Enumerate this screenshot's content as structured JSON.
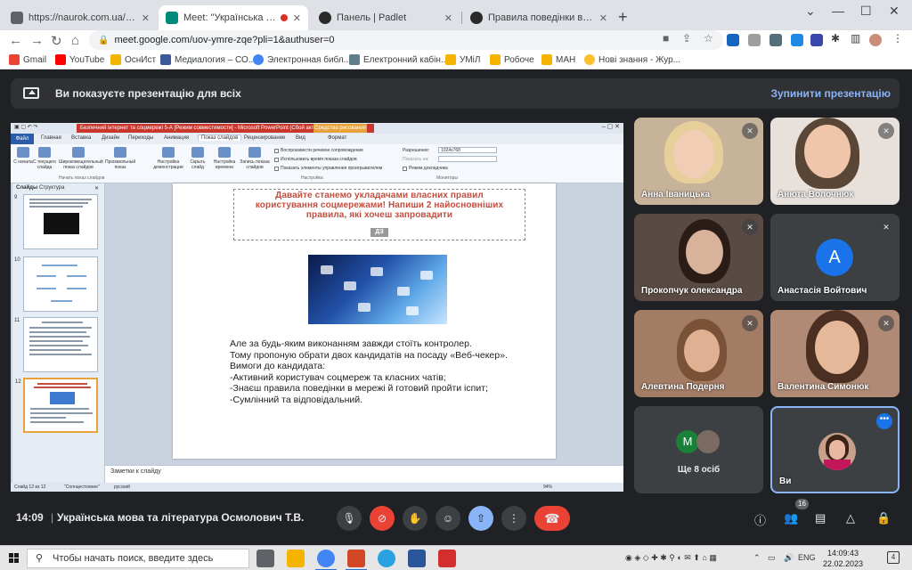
{
  "browser": {
    "tabs": [
      {
        "title": "https://naurok.com.ua/test/realti"
      },
      {
        "title": "Meet: \"Українська мова та л"
      },
      {
        "title": "Панель | Padlet"
      },
      {
        "title": "Правила поведінки в мережі уч"
      }
    ],
    "url": "meet.google.com/uov-ymre-zqe?pli=1&authuser=0",
    "bookmarks": [
      "Gmail",
      "YouTube",
      "ОснИст",
      "Медиалогия – СО...",
      "Электронная библ...",
      "Електронний кабін...",
      "УМіЛ",
      "Робоче",
      "МАН",
      "Нові знання - Жур..."
    ]
  },
  "meet": {
    "banner_message": "Ви показуєте презентацію для всіх",
    "stop_button": "Зупинити презентацію",
    "time": "14:09",
    "separator": "|",
    "meeting_name": "Українська мова та література Осмолович Т.В.",
    "participants_count": "16",
    "participants": [
      {
        "name": "Анна Іваницька",
        "muted": true
      },
      {
        "name": "Анюта Волочнюк",
        "muted": true
      },
      {
        "name": "Прокопчук олександра",
        "muted": true
      },
      {
        "name": "Анастасія Войтович",
        "muted": true,
        "initial": "A"
      },
      {
        "name": "Алевтина Подерня",
        "muted": true
      },
      {
        "name": "Валентина Симонюк",
        "muted": true
      }
    ],
    "more_tile": {
      "label": "Ще 8 осіб",
      "initial": "M"
    },
    "self_tile": {
      "label": "Ви"
    }
  },
  "powerpoint": {
    "title_bar": "Безпечний інтернет та соцмережі 5-А [Режим совместимости] - Microsoft PowerPoint (Сбой активац...",
    "tools_label": "Средства рисования",
    "tabs": [
      "Файл",
      "Главная",
      "Вставка",
      "Дизайн",
      "Переходы",
      "Анимация",
      "Показ слайдов",
      "Рецензирование",
      "Вид",
      "Формат"
    ],
    "ribbon_buttons": [
      "С начала",
      "С текущего слайда",
      "Широковещательный показ слайдов",
      "Произвольный показ",
      "Настройка демонстрации",
      "Скрыть слайд",
      "Настройка времени",
      "Запись показа слайдов"
    ],
    "ribbon_checks": [
      "Воспроизвести речевое сопровождение",
      "Использовать время показа слайдов",
      "Показать элементы управления проигрывателем"
    ],
    "ribbon_right": [
      "Разрешение:",
      "1024x768",
      "Показать на:",
      "Режим докладчика"
    ],
    "groups": [
      "Начать показ слайдов",
      "Настройка",
      "Мониторы"
    ],
    "left_tabs": [
      "Слайды",
      "Структура"
    ],
    "thumb_numbers": [
      "9",
      "10",
      "11",
      "12"
    ],
    "slide": {
      "title_lines": [
        "Давайте станемо укладачами власних правил",
        "користування соцмережами! Напиши 2 найосновніших",
        "правила, які хочеш запровадити"
      ],
      "tag": "ДЗ",
      "body": [
        "Але за будь-яким виконанням завжди стоїть контролер.",
        "Тому пропоную обрати двох кандидатів на посаду «Веб-чекер».",
        "Вимоги до кандидата:",
        "-Активний користувач соцмереж та класних чатів;",
        "-Знаєш правила поведінки в мережі й готовий пройти іспит;",
        "-Сумлінний та відповідальний."
      ]
    },
    "notes_placeholder": "Заметки к слайду",
    "status": {
      "slide": "Слайд 12 из 12",
      "theme": "\"Солнцестояние\"",
      "lang": "русский",
      "zoom": "94%"
    }
  },
  "taskbar": {
    "search_placeholder": "Чтобы начать поиск, введите здесь",
    "lang": "ENG",
    "time": "14:09:43",
    "date": "22.02.2023",
    "notifications": "4"
  }
}
